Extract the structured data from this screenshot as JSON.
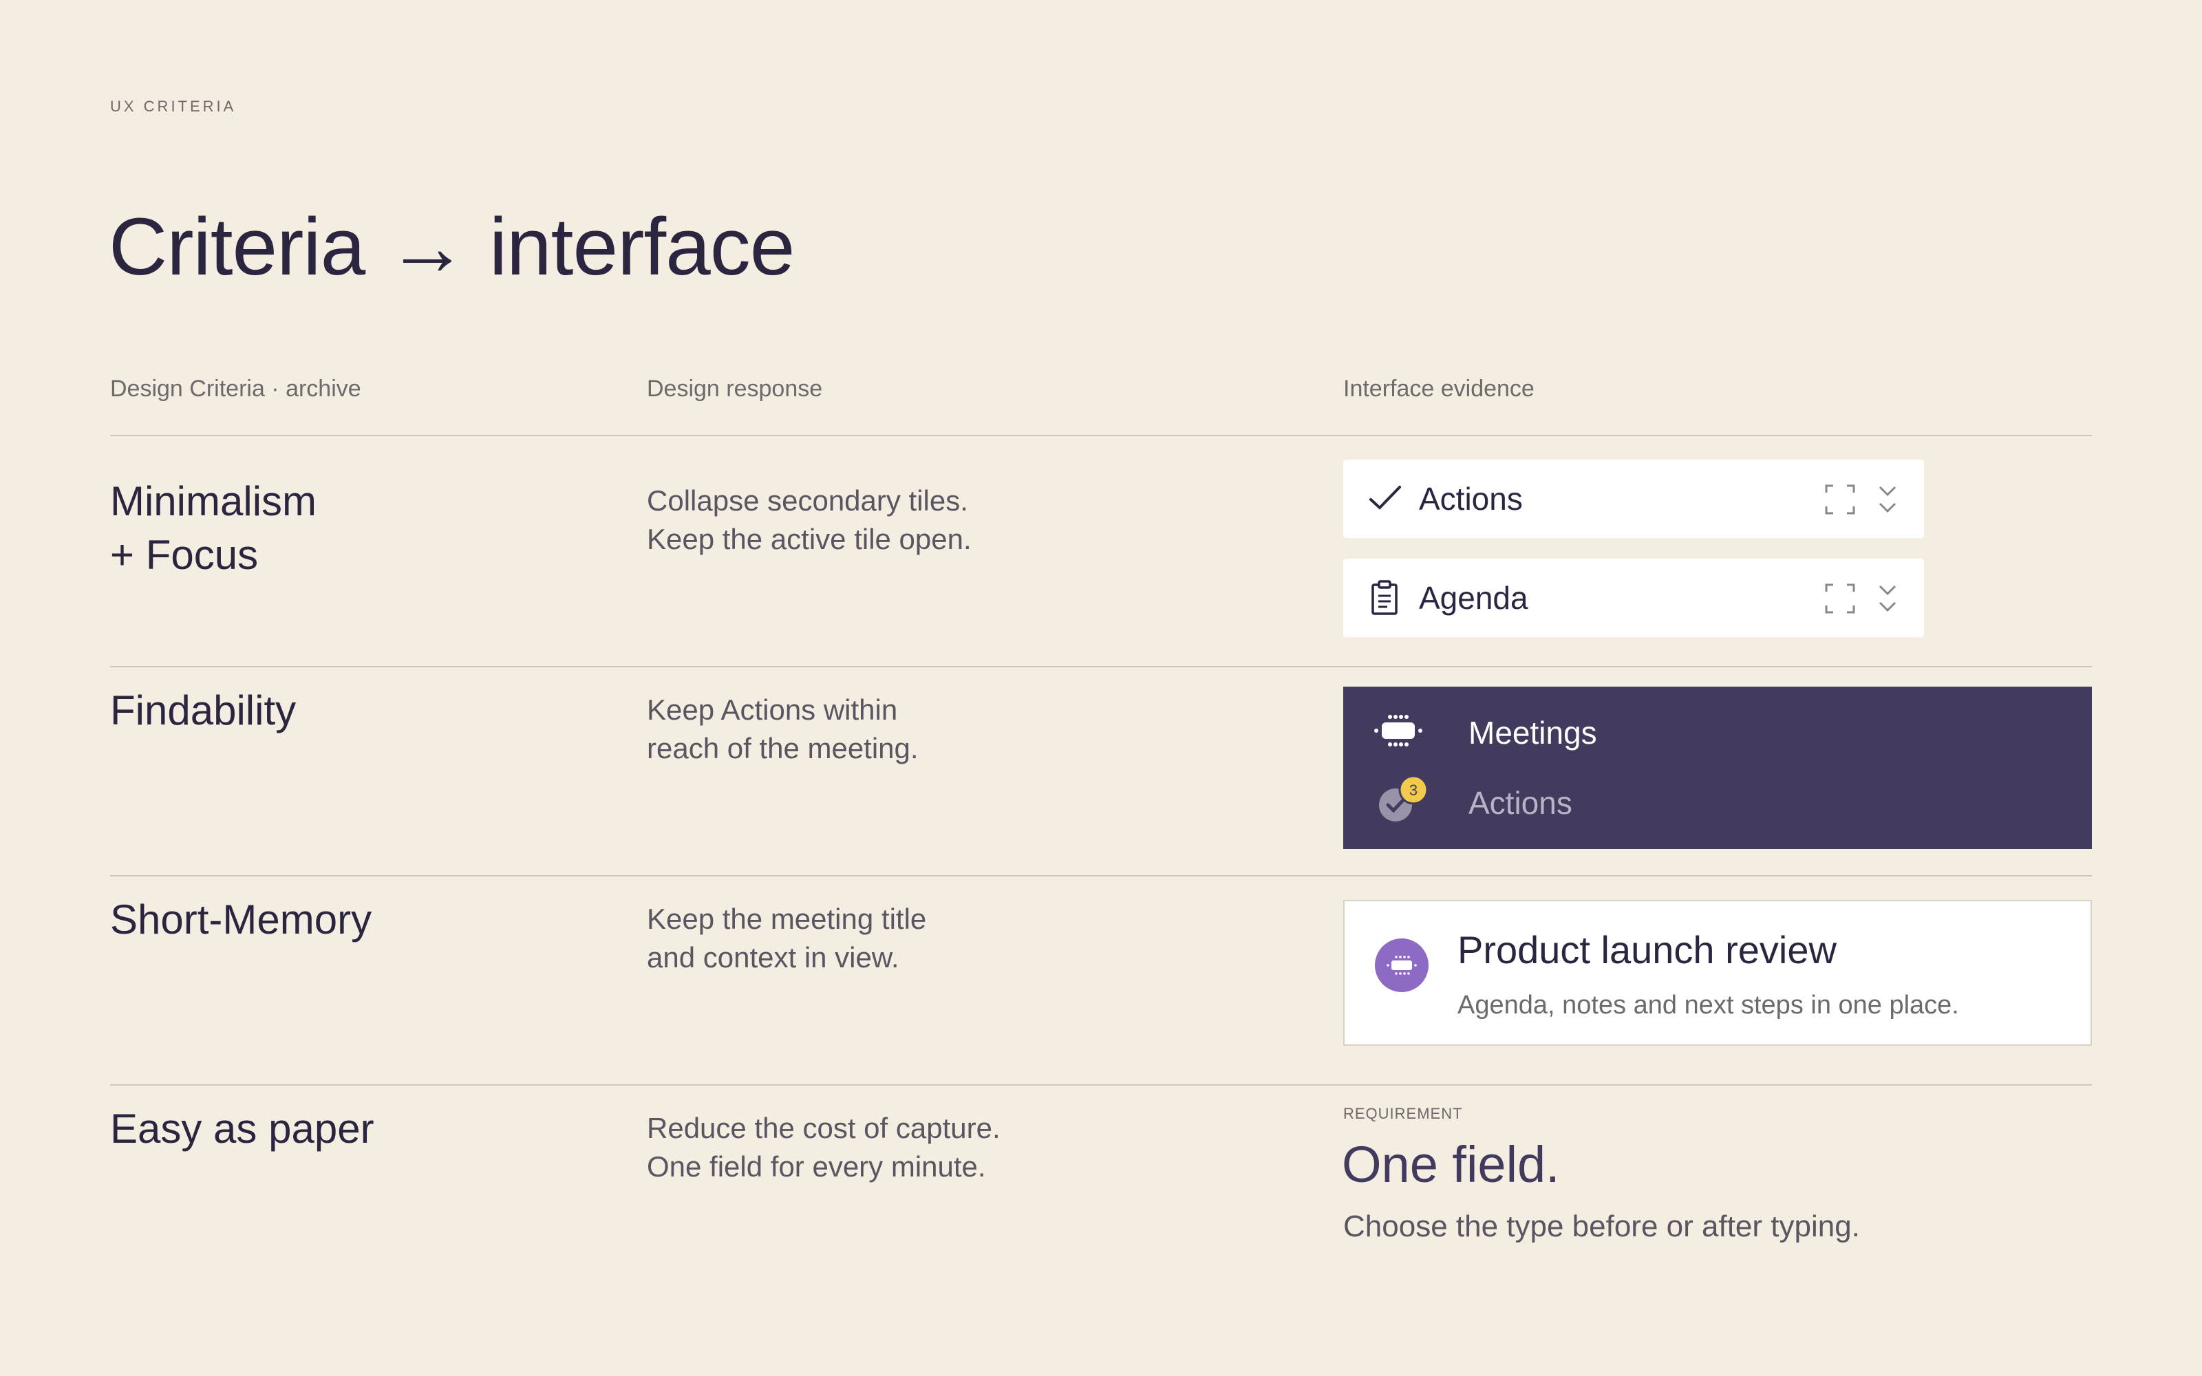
{
  "eyebrow": "UX CRITERIA",
  "title": "Criteria → interface",
  "columns": {
    "criteria": "Design Criteria · archive",
    "response": "Design response",
    "evidence": "Interface evidence"
  },
  "rows": [
    {
      "criterion": [
        "Minimalism",
        "+ Focus"
      ],
      "response": [
        "Collapse secondary tiles.",
        "Keep the active tile open."
      ]
    },
    {
      "criterion": [
        "Findability"
      ],
      "response": [
        "Keep Actions within",
        "reach of the meeting."
      ]
    },
    {
      "criterion": [
        "Short-Memory"
      ],
      "response": [
        "Keep the meeting title",
        "and context in view."
      ]
    },
    {
      "criterion": [
        "Easy as paper"
      ],
      "response": [
        "Reduce the cost of capture.",
        "One field for every minute."
      ]
    }
  ],
  "tiles": [
    {
      "label": "Actions",
      "icon": "check-icon"
    },
    {
      "label": "Agenda",
      "icon": "clipboard-icon"
    }
  ],
  "nav": {
    "items": [
      {
        "label": "Meetings",
        "icon": "meeting-table-icon"
      },
      {
        "label": "Actions",
        "icon": "check-circle-icon",
        "badge": "3"
      }
    ],
    "colors": {
      "background": "#433b5d",
      "badge": "#f2c94c"
    }
  },
  "meeting_card": {
    "title": "Product launch review",
    "subtitle": "Agenda, notes and next steps in one place.",
    "avatar_color": "#8d6bc4"
  },
  "requirement": {
    "eyebrow": "REQUIREMENT",
    "heading": "One field.",
    "text": "Choose the type before or after typing."
  }
}
